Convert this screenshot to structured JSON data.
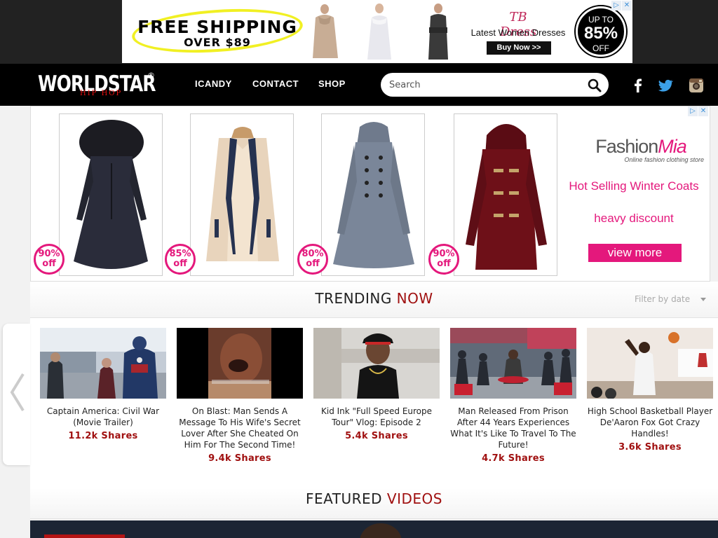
{
  "top_ad": {
    "headline": "FREE SHIPPING",
    "subline": "OVER $89",
    "brand": "TB Dress",
    "tagline": "Latest Women Dresses",
    "cta": "Buy Now >>",
    "badge_top": "UP TO",
    "badge_pct": "85%",
    "badge_bottom": "OFF"
  },
  "header": {
    "logo_main": "WORLDSTAR",
    "logo_sub": "HIP HOP",
    "logo_mark": "®",
    "nav": [
      "ICANDY",
      "CONTACT",
      "SHOP"
    ],
    "search_placeholder": "Search",
    "social_icons": [
      "facebook-icon",
      "twitter-icon",
      "instagram-icon"
    ]
  },
  "mid_ad": {
    "discounts": [
      "90% off",
      "85% off",
      "80% off",
      "90% off"
    ],
    "brand_a": "Fashion",
    "brand_b": "Mia",
    "brand_sub": "Online fashion clothing store",
    "headline": "Hot Selling Winter Coats",
    "subline": "heavy discount",
    "cta": "view more"
  },
  "trending": {
    "title_a": "TRENDING",
    "title_b": "NOW",
    "filter": "Filter by date",
    "items": [
      {
        "title": "Captain America: Civil War (Movie Trailer)",
        "shares": "11.2k Shares"
      },
      {
        "title": "On Blast: Man Sends A Message To His Wife's Secret Lover After She Cheated On Him For The Second Time!",
        "shares": "9.4k Shares"
      },
      {
        "title": "Kid Ink \"Full Speed Europe Tour\" Vlog: Episode 2",
        "shares": "5.4k Shares"
      },
      {
        "title": "Man Released From Prison After 44 Years Experiences What It's Like To Travel To The Future!",
        "shares": "4.7k Shares"
      },
      {
        "title": "High School Basketball Player De'Aaron Fox Got Crazy Handles!",
        "shares": "3.6k Shares"
      }
    ]
  },
  "featured": {
    "title_a": "FEATURED",
    "title_b": "VIDEOS"
  },
  "colors": {
    "accent_red": "#a01010",
    "ad_pink": "#e4187c",
    "header_bg": "#000000"
  }
}
